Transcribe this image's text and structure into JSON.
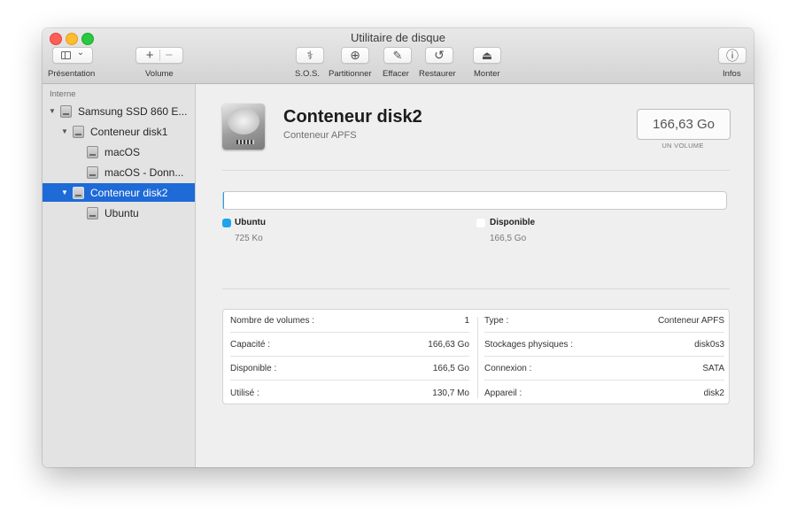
{
  "window": {
    "title": "Utilitaire de disque"
  },
  "toolbar": {
    "presentation_label": "Présentation",
    "volume_label": "Volume",
    "add_glyph": "+",
    "remove_glyph": "−",
    "chevron_glyph": "⌄",
    "sos_label": "S.O.S.",
    "partition_label": "Partitionner",
    "erase_label": "Effacer",
    "restore_label": "Restaurer",
    "mount_label": "Monter",
    "info_label": "Infos",
    "sos_glyph": "⚕",
    "partition_glyph": "⊕",
    "erase_glyph": "✎",
    "restore_glyph": "↺",
    "mount_glyph": "⏏",
    "info_glyph": "ⓘ"
  },
  "sidebar": {
    "section": "Interne",
    "items": [
      {
        "label": "Samsung SSD 860 E...",
        "level": 0,
        "expanded": true,
        "selected": false
      },
      {
        "label": "Conteneur disk1",
        "level": 1,
        "expanded": true,
        "selected": false
      },
      {
        "label": "macOS",
        "level": 2,
        "expanded": null,
        "selected": false
      },
      {
        "label": "macOS - Donn...",
        "level": 2,
        "expanded": null,
        "selected": false
      },
      {
        "label": "Conteneur disk2",
        "level": 1,
        "expanded": true,
        "selected": true
      },
      {
        "label": "Ubuntu",
        "level": 2,
        "expanded": null,
        "selected": false
      }
    ],
    "disclosure_glyph": "▼",
    "selected_color": "#1e6ad6"
  },
  "main": {
    "title": "Conteneur disk2",
    "subtitle": "Conteneur APFS",
    "size": "166,63 Go",
    "size_caption": "UN VOLUME",
    "usage": {
      "used_fraction": 4.4e-06,
      "legend": [
        {
          "name": "Ubuntu",
          "value": "725 Ko",
          "color": "#1fa3ee"
        },
        {
          "name": "Disponible",
          "value": "166,5 Go",
          "color": "#ffffff"
        }
      ]
    },
    "info_left": [
      {
        "label": "Nombre de volumes :",
        "value": "1"
      },
      {
        "label": "Capacité :",
        "value": "166,63 Go"
      },
      {
        "label": "Disponible :",
        "value": "166,5 Go"
      },
      {
        "label": "Utilisé :",
        "value": "130,7 Mo"
      }
    ],
    "info_right": [
      {
        "label": "Type :",
        "value": "Conteneur APFS"
      },
      {
        "label": "Stockages physiques :",
        "value": "disk0s3"
      },
      {
        "label": "Connexion :",
        "value": "SATA"
      },
      {
        "label": "Appareil :",
        "value": "disk2"
      }
    ]
  }
}
